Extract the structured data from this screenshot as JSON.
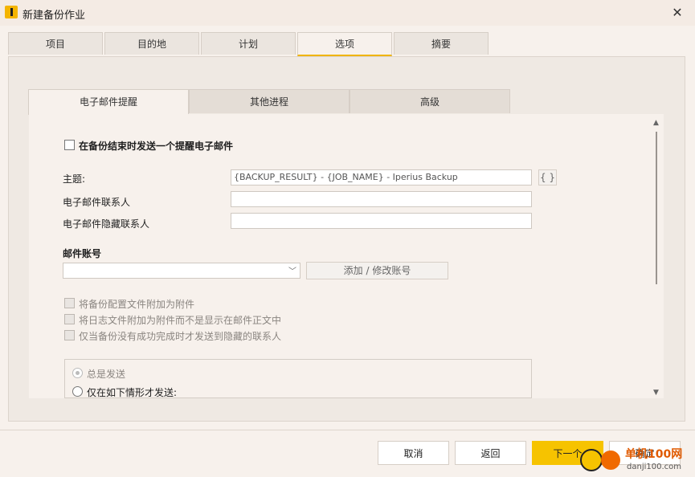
{
  "window": {
    "title": "新建备份作业",
    "close_icon": "close-icon"
  },
  "top_tabs": [
    {
      "label": "项目"
    },
    {
      "label": "目的地"
    },
    {
      "label": "计划"
    },
    {
      "label": "选项",
      "active": true
    },
    {
      "label": "摘要"
    }
  ],
  "inner_tabs": [
    {
      "label": "电子邮件提醒",
      "active": true
    },
    {
      "label": "其他进程"
    },
    {
      "label": "高级"
    }
  ],
  "email": {
    "send_checkbox_label": "在备份结束时发送一个提醒电子邮件",
    "subject_label": "主题:",
    "subject_value": "{BACKUP_RESULT} - {JOB_NAME} - Iperius Backup",
    "variables_button": "{ }",
    "recipients_label": "电子邮件联系人",
    "recipients_value": "",
    "bcc_label": "电子邮件隐藏联系人",
    "bcc_value": "",
    "account_section": "邮件账号",
    "account_selected": "",
    "add_account_button": "添加 / 修改账号",
    "attach_config_label": "将备份配置文件附加为附件",
    "attach_log_label": "将日志文件附加为附件而不是显示在邮件正文中",
    "bcc_only_on_fail_label": "仅当备份没有成功完成时才发送到隐藏的联系人",
    "always_send_label": "总是发送",
    "conditional_send_label": "仅在如下情形才发送:"
  },
  "footer": {
    "cancel": "取消",
    "back": "返回",
    "next": "下一个",
    "ok": "确定"
  },
  "watermark": {
    "site": "单机100网",
    "url": "danji100.com"
  }
}
